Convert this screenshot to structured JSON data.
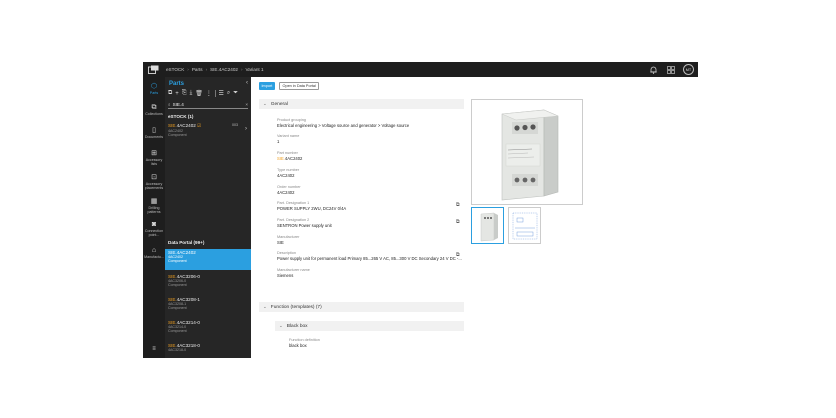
{
  "topbar": {
    "breadcrumbs": [
      "eSTOCK",
      "Parts",
      "SIE.4AC2402",
      "Variant 1"
    ],
    "initials": "MT",
    "icons": [
      "app-logo-icon",
      "bell-icon",
      "apps-grid-icon"
    ]
  },
  "rail": {
    "items": [
      {
        "label": "Parts",
        "icon": "parts-icon"
      },
      {
        "label": "Collections",
        "icon": "collections-icon"
      },
      {
        "label": "Documents",
        "icon": "documents-icon"
      },
      {
        "label": "Accessory lists",
        "icon": "accessory-lists-icon"
      },
      {
        "label": "Accessory placements",
        "icon": "accessory-placements-icon"
      },
      {
        "label": "Drilling patterns",
        "icon": "drilling-patterns-icon"
      },
      {
        "label": "Connection point...",
        "icon": "connection-points-icon"
      },
      {
        "label": "Manufactu...",
        "icon": "manufacturers-icon"
      }
    ],
    "menu_icon": "menu-icon"
  },
  "parts_panel": {
    "title": "Parts",
    "search_value": "SIE.4",
    "estock_group": "eSTOCK (1)",
    "estock_items": [
      {
        "prefix": "SIE.",
        "name": "4AC2402",
        "sub1": "4AC2402",
        "sub2": "Component",
        "badge": "003"
      }
    ],
    "portal_group": "Data Portal (99+)",
    "portal_items": [
      {
        "prefix": "SIE.",
        "name": "4AC2402",
        "sub1": "4AC2402",
        "sub2": "Component"
      },
      {
        "prefix": "SIE.",
        "name": "4AC3206-0",
        "sub1": "4AC3206-0",
        "sub2": "Component"
      },
      {
        "prefix": "SIE.",
        "name": "4AC3208-1",
        "sub1": "4AC3208-1",
        "sub2": "Component"
      },
      {
        "prefix": "SIE.",
        "name": "4AC3214-0",
        "sub1": "4AC3214-0",
        "sub2": "Component"
      },
      {
        "prefix": "SIE.",
        "name": "4AC3218-0",
        "sub1": "4AC3218-0",
        "sub2": ""
      }
    ]
  },
  "main": {
    "import_label": "Import",
    "open_portal_label": "Open in Data Portal",
    "general_title": "General",
    "fields": [
      {
        "label": "Product grouping",
        "value": "Electrical engineering > Voltage source and generator > Voltage source"
      },
      {
        "label": "Variant name",
        "value": "1"
      },
      {
        "label": "Part number",
        "prefix": "SIE.",
        "value": "4AC2402"
      },
      {
        "label": "Type number",
        "value": "4AC2402"
      },
      {
        "label": "Order number",
        "value": "4AC2402"
      },
      {
        "label": "Part. Designation 1",
        "value": "POWER SUPPLY 2WU, DC24V 0/4A"
      },
      {
        "label": "Part. Designation 2",
        "value": "SENTRON Power supply unit"
      },
      {
        "label": "Manufacturer",
        "value": "SIE"
      },
      {
        "label": "Description",
        "value": "Power supply unit for permanent load Primary 85...265 V AC, 85...300 V DC Secondary 24 V DC -..."
      },
      {
        "label": "Manufacturer name",
        "value": "Siemens"
      }
    ],
    "function_title": "Function (templates) (7)",
    "blackbox_title": "Black box",
    "function_field": {
      "label": "Function definition",
      "value": "black box"
    },
    "thumbs_icons": [
      "photo-thumbnail-icon",
      "drawing-thumbnail-icon"
    ]
  },
  "colors": {
    "accent": "#2b9fe0",
    "dark": "#1e1e1e",
    "panel": "#262626",
    "prefix": "#f0a020"
  }
}
